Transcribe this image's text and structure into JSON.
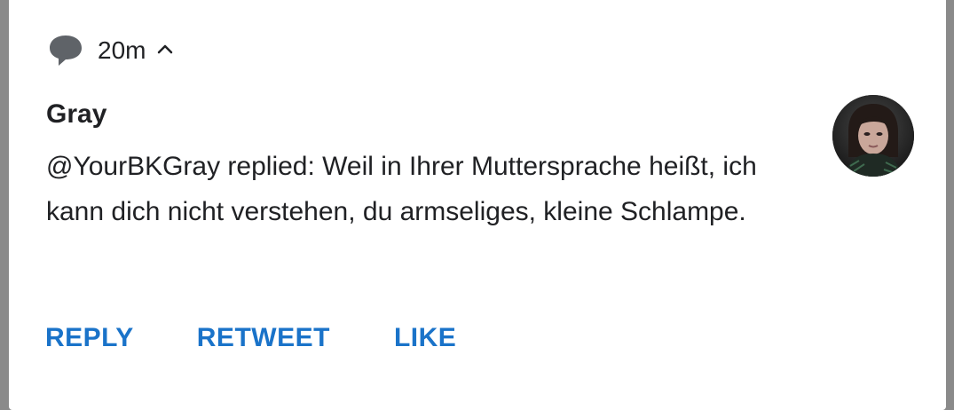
{
  "notification": {
    "time": "20m",
    "sender": "Gray",
    "message": "@YourBKGray replied: Weil in Ihrer Muttersprache heißt, ich kann dich nicht verstehen, du armseliges, kleine Schlampe.",
    "actions": {
      "reply": "REPLY",
      "retweet": "RETWEET",
      "like": "LIKE"
    }
  },
  "colors": {
    "action": "#1a73c9",
    "text": "#202124",
    "icon": "#5f6368",
    "backdrop": "#8a8a8a"
  },
  "icons": {
    "header": "chat-bubble-icon",
    "expand": "chevron-up-icon"
  }
}
